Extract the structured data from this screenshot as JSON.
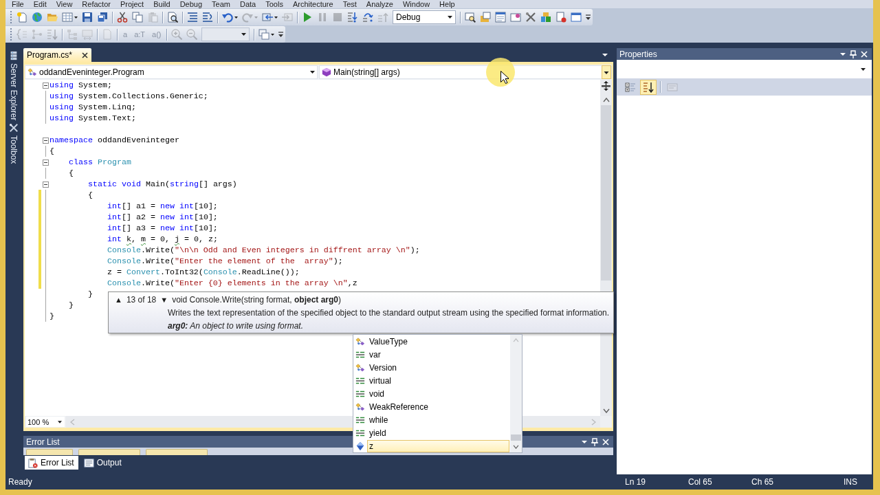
{
  "menu": [
    "File",
    "Edit",
    "View",
    "Refactor",
    "Project",
    "Build",
    "Debug",
    "Team",
    "Data",
    "Tools",
    "Architecture",
    "Test",
    "Analyze",
    "Window",
    "Help"
  ],
  "toolbars": [
    {
      "items": [
        {
          "kind": "button",
          "disabled": false
        },
        {
          "kind": "button",
          "disabled": false
        },
        {
          "kind": "button",
          "disabled": false
        },
        {
          "kind": "split",
          "disabled": false
        },
        {
          "kind": "button",
          "disabled": false
        },
        {
          "kind": "button",
          "disabled": false
        },
        {
          "kind": "separator"
        },
        {
          "kind": "button",
          "disabled": false
        },
        {
          "kind": "button",
          "disabled": false
        },
        {
          "kind": "button",
          "disabled": true
        },
        {
          "kind": "separator"
        },
        {
          "kind": "button",
          "disabled": false
        },
        {
          "kind": "separator"
        },
        {
          "kind": "button",
          "disabled": false
        },
        {
          "kind": "button",
          "disabled": false
        },
        {
          "kind": "separator"
        },
        {
          "kind": "split",
          "disabled": false
        },
        {
          "kind": "split",
          "disabled": true
        },
        {
          "kind": "split",
          "disabled": false
        },
        {
          "kind": "button",
          "disabled": true
        },
        {
          "kind": "separator"
        },
        {
          "kind": "button",
          "disabled": false
        },
        {
          "kind": "button",
          "disabled": true
        },
        {
          "kind": "button",
          "disabled": true
        },
        {
          "kind": "button",
          "disabled": false
        },
        {
          "kind": "button",
          "disabled": false
        },
        {
          "kind": "button",
          "disabled": true
        },
        {
          "kind": "combo",
          "value": "Debug",
          "disabled": false
        },
        {
          "kind": "separator"
        },
        {
          "kind": "button",
          "disabled": false
        },
        {
          "kind": "button",
          "disabled": false
        },
        {
          "kind": "button",
          "disabled": false
        },
        {
          "kind": "button",
          "disabled": false
        },
        {
          "kind": "button",
          "disabled": false
        },
        {
          "kind": "button",
          "disabled": false
        },
        {
          "kind": "button",
          "disabled": false
        },
        {
          "kind": "button",
          "disabled": false
        }
      ]
    },
    {
      "items": [
        {
          "kind": "button",
          "disabled": true
        },
        {
          "kind": "button",
          "disabled": true
        },
        {
          "kind": "button",
          "disabled": true
        },
        {
          "kind": "separator"
        },
        {
          "kind": "button",
          "disabled": true
        },
        {
          "kind": "button",
          "disabled": true
        },
        {
          "kind": "separator"
        },
        {
          "kind": "button",
          "disabled": true
        },
        {
          "kind": "separator"
        },
        {
          "kind": "button",
          "label": "a",
          "disabled": true
        },
        {
          "kind": "button",
          "label": "a:T",
          "disabled": true
        },
        {
          "kind": "button",
          "label": "a()",
          "disabled": true
        },
        {
          "kind": "separator"
        },
        {
          "kind": "button",
          "disabled": true
        },
        {
          "kind": "button",
          "disabled": true
        },
        {
          "kind": "combo",
          "disabled": true
        },
        {
          "kind": "separator"
        },
        {
          "kind": "split",
          "disabled": false
        }
      ]
    }
  ],
  "side_tabs": [
    {
      "label": "Server Explorer"
    },
    {
      "label": "Toolbox"
    }
  ],
  "editor": {
    "tab": {
      "label": "Program.cs*",
      "selected": true
    },
    "nav": [
      {
        "value": "oddandEveninteger.Program",
        "highlighted": false
      },
      {
        "value": "Main(string[] args)",
        "highlighted": true
      }
    ],
    "lines": [
      {
        "kind": "code",
        "fold": true,
        "changed": false,
        "tokens": [
          {
            "text": "using",
            "kind": "keyword"
          },
          {
            "text": " System;",
            "kind": "plain"
          }
        ]
      },
      {
        "kind": "code",
        "fold": false,
        "changed": false,
        "tokens": [
          {
            "text": "using",
            "kind": "keyword"
          },
          {
            "text": " System.Collections.Generic;",
            "kind": "plain"
          }
        ]
      },
      {
        "kind": "code",
        "fold": false,
        "changed": false,
        "tokens": [
          {
            "text": "using",
            "kind": "keyword"
          },
          {
            "text": " System.Linq;",
            "kind": "plain"
          }
        ]
      },
      {
        "kind": "code",
        "fold": false,
        "changed": false,
        "tokens": [
          {
            "text": "using",
            "kind": "keyword"
          },
          {
            "text": " System.Text;",
            "kind": "plain"
          }
        ]
      },
      {
        "kind": "blank"
      },
      {
        "kind": "code",
        "fold": true,
        "changed": false,
        "tokens": [
          {
            "text": "namespace",
            "kind": "keyword"
          },
          {
            "text": " oddandEveninteger",
            "kind": "plain"
          }
        ]
      },
      {
        "kind": "code",
        "fold": false,
        "changed": false,
        "tokens": [
          {
            "text": "{",
            "kind": "plain"
          }
        ]
      },
      {
        "kind": "code",
        "fold": true,
        "changed": false,
        "tokens": [
          {
            "text": "    class",
            "kind": "keyword"
          },
          {
            "text": " Program",
            "kind": "type"
          }
        ]
      },
      {
        "kind": "code",
        "fold": false,
        "changed": false,
        "tokens": [
          {
            "text": "    {",
            "kind": "plain"
          }
        ]
      },
      {
        "kind": "code",
        "fold": true,
        "changed": false,
        "tokens": [
          {
            "text": "        static void",
            "kind": "keyword"
          },
          {
            "text": " Main(",
            "kind": "plain"
          },
          {
            "text": "string",
            "kind": "keyword"
          },
          {
            "text": "[] args)",
            "kind": "plain"
          }
        ]
      },
      {
        "kind": "code",
        "fold": false,
        "changed": true,
        "tokens": [
          {
            "text": "        {",
            "kind": "plain"
          }
        ]
      },
      {
        "kind": "code",
        "fold": false,
        "changed": true,
        "tokens": [
          {
            "text": "            int",
            "kind": "keyword"
          },
          {
            "text": "[] a1 = ",
            "kind": "plain"
          },
          {
            "text": "new int",
            "kind": "keyword"
          },
          {
            "text": "[10];",
            "kind": "plain"
          }
        ]
      },
      {
        "kind": "code",
        "fold": false,
        "changed": true,
        "tokens": [
          {
            "text": "            int",
            "kind": "keyword"
          },
          {
            "text": "[] a2 = ",
            "kind": "plain"
          },
          {
            "text": "new int",
            "kind": "keyword"
          },
          {
            "text": "[10];",
            "kind": "plain"
          }
        ]
      },
      {
        "kind": "code",
        "fold": false,
        "changed": true,
        "tokens": [
          {
            "text": "            int",
            "kind": "keyword"
          },
          {
            "text": "[] a3 = ",
            "kind": "plain"
          },
          {
            "text": "new int",
            "kind": "keyword"
          },
          {
            "text": "[10];",
            "kind": "plain"
          }
        ]
      },
      {
        "kind": "code",
        "fold": false,
        "changed": true,
        "tokens": [
          {
            "text": "            int ",
            "kind": "keyword"
          },
          {
            "text": "k",
            "kind": "warning"
          },
          {
            "text": ", ",
            "kind": "plain"
          },
          {
            "text": "m",
            "kind": "warning"
          },
          {
            "text": " = 0, ",
            "kind": "plain"
          },
          {
            "text": "j",
            "kind": "warning"
          },
          {
            "text": " = 0, z;",
            "kind": "plain"
          }
        ]
      },
      {
        "kind": "code",
        "fold": false,
        "changed": true,
        "tokens": [
          {
            "text": "            Console",
            "kind": "type"
          },
          {
            "text": ".Write(",
            "kind": "plain"
          },
          {
            "text": "\"\\n\\n Odd and Even integers in diffrent array \\n\"",
            "kind": "string"
          },
          {
            "text": ");",
            "kind": "plain"
          }
        ]
      },
      {
        "kind": "code",
        "fold": false,
        "changed": true,
        "tokens": [
          {
            "text": "            Console",
            "kind": "type"
          },
          {
            "text": ".Write(",
            "kind": "plain"
          },
          {
            "text": "\"Enter the element of the  array\"",
            "kind": "string"
          },
          {
            "text": ");",
            "kind": "plain"
          }
        ]
      },
      {
        "kind": "code",
        "fold": false,
        "changed": true,
        "tokens": [
          {
            "text": "            z = ",
            "kind": "plain"
          },
          {
            "text": "Convert",
            "kind": "type"
          },
          {
            "text": ".ToInt32(",
            "kind": "plain"
          },
          {
            "text": "Console",
            "kind": "type"
          },
          {
            "text": ".ReadLine());",
            "kind": "plain"
          }
        ]
      },
      {
        "kind": "code",
        "fold": false,
        "changed": true,
        "tokens": [
          {
            "text": "            Console",
            "kind": "type"
          },
          {
            "text": ".Write(",
            "kind": "plain"
          },
          {
            "text": "\"Enter {0} elements in the array \\n\"",
            "kind": "string"
          },
          {
            "text": ",z",
            "kind": "plain"
          }
        ]
      },
      {
        "kind": "code",
        "fold": false,
        "changed": false,
        "tokens": [
          {
            "text": "        }",
            "kind": "plain"
          }
        ]
      },
      {
        "kind": "code",
        "fold": false,
        "changed": false,
        "tokens": [
          {
            "text": "    }",
            "kind": "plain"
          }
        ]
      },
      {
        "kind": "code",
        "fold": false,
        "changed": false,
        "tokens": [
          {
            "text": "}",
            "kind": "plain"
          }
        ]
      }
    ],
    "zoom": "100 %"
  },
  "signature_help": {
    "previous": "▲",
    "counter": "13 of 18",
    "next": "▼",
    "signature": "void Console.Write(string format, **object arg0**)",
    "description": "Writes the text representation of the specified object to the standard output stream using the specified format information.",
    "parameter": "**arg0:** An object to write using format."
  },
  "completion_list": [
    {
      "label": "ValueType",
      "kind": "class",
      "selected": false
    },
    {
      "label": "var",
      "kind": "keyword",
      "selected": false
    },
    {
      "label": "Version",
      "kind": "class",
      "selected": false
    },
    {
      "label": "virtual",
      "kind": "keyword",
      "selected": false
    },
    {
      "label": "void",
      "kind": "keyword",
      "selected": false
    },
    {
      "label": "WeakReference",
      "kind": "class",
      "selected": false
    },
    {
      "label": "while",
      "kind": "keyword",
      "selected": false
    },
    {
      "label": "yield",
      "kind": "keyword",
      "selected": false
    },
    {
      "label": "z",
      "kind": "local",
      "selected": true
    }
  ],
  "error_list": {
    "title": "Error List"
  },
  "tool_tabs": [
    {
      "label": "Error List",
      "selected": true
    },
    {
      "label": "Output",
      "selected": false
    }
  ],
  "properties_panel": {
    "title": "Properties",
    "toolbar": [
      {
        "selected": false,
        "disabled": false
      },
      {
        "selected": true,
        "disabled": false
      },
      {
        "selected": false,
        "disabled": true
      }
    ]
  },
  "status_bar": {
    "message": "Ready",
    "line": "Ln 19",
    "column": "Col 65",
    "char": "Ch 65",
    "mode": "INS"
  }
}
